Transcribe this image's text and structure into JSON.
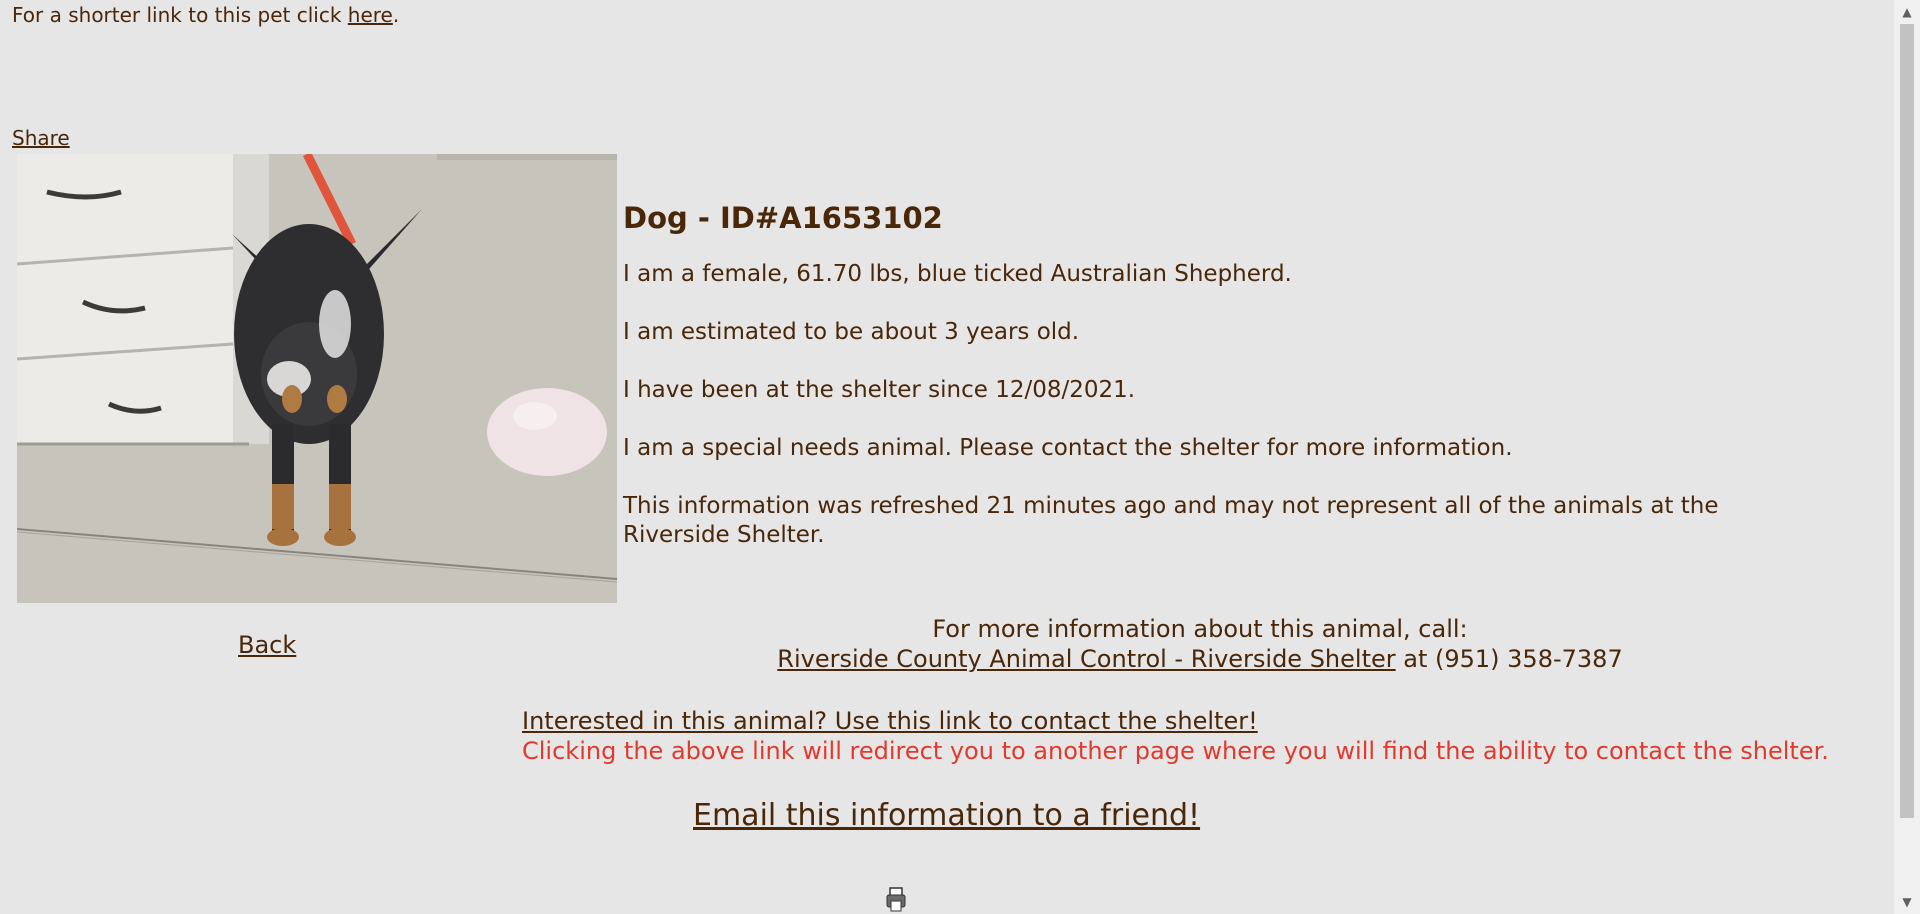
{
  "top": {
    "short_link_prefix": "For a shorter link to this pet click ",
    "short_link_text": "here",
    "short_link_suffix": ".",
    "share_label": "Share"
  },
  "pet": {
    "heading": "Dog - ID#A1653102",
    "description": "I am a female, 61.70 lbs, blue ticked Australian Shepherd.",
    "age": "I am estimated to be about 3 years old.",
    "since": "I have been at the shelter since 12/08/2021.",
    "special_needs": "I am a special needs animal. Please contact the shelter for more information.",
    "refresh_note": "This information was refreshed 21 minutes ago and may not represent all of the animals at the Riverside Shelter."
  },
  "nav": {
    "back_label": "Back"
  },
  "contact": {
    "intro": "For more information about this animal, call:",
    "shelter_name": "Riverside County Animal Control - Riverside Shelter",
    "phone_prefix": " at (951) 358-7387",
    "interest_link": "Interested in this animal? Use this link to contact the shelter!",
    "redirect_warning": "Clicking the above link will redirect you to another page where you will find the ability to contact the shelter.",
    "email_link": "Email this information to a friend!"
  },
  "colors": {
    "background": "#e6e6e6",
    "text": "#4a2708",
    "warning": "#e03a2f"
  },
  "icons": {
    "scroll_up": "chevron-up-icon",
    "scroll_down": "chevron-down-icon",
    "bottom": "printer-icon"
  }
}
